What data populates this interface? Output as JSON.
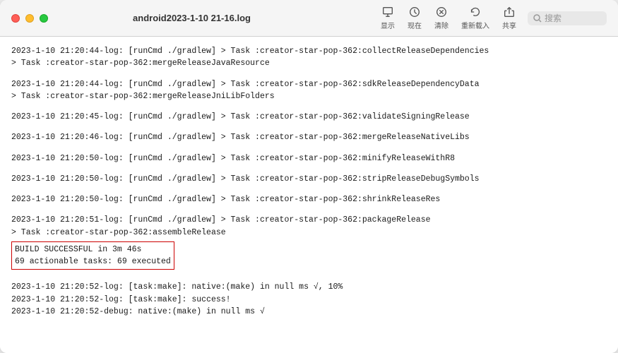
{
  "window": {
    "title": "android2023-1-10 21-16.log"
  },
  "toolbar": {
    "display_label": "显示",
    "now_label": "现在",
    "clear_label": "清除",
    "reload_label": "重新载入",
    "share_label": "共享",
    "search_placeholder": "搜索"
  },
  "log_lines": [
    "2023-1-10 21:20:44-log: [runCmd ./gradlew] > Task :creator-star-pop-362:collectReleaseDependencies",
    "> Task :creator-star-pop-362:mergeReleaseJavaResource",
    "",
    "2023-1-10 21:20:44-log: [runCmd ./gradlew] > Task :creator-star-pop-362:sdkReleaseDependencyData",
    "> Task :creator-star-pop-362:mergeReleaseJniLibFolders",
    "",
    "2023-1-10 21:20:45-log: [runCmd ./gradlew] > Task :creator-star-pop-362:validateSigningRelease",
    "",
    "2023-1-10 21:20:46-log: [runCmd ./gradlew] > Task :creator-star-pop-362:mergeReleaseNativeLibs",
    "",
    "2023-1-10 21:20:50-log: [runCmd ./gradlew] > Task :creator-star-pop-362:minifyReleaseWithR8",
    "",
    "2023-1-10 21:20:50-log: [runCmd ./gradlew] > Task :creator-star-pop-362:stripReleaseDebugSymbols",
    "",
    "2023-1-10 21:20:50-log: [runCmd ./gradlew] > Task :creator-star-pop-362:shrinkReleaseRes",
    "",
    "2023-1-10 21:20:51-log: [runCmd ./gradlew] > Task :creator-star-pop-362:packageRelease",
    "> Task :creator-star-pop-362:assembleRelease"
  ],
  "build_success": {
    "line1": "BUILD SUCCESSFUL in 3m 46s",
    "line2": "69 actionable tasks: 69 executed"
  },
  "log_lines_after": [
    "",
    "2023-1-10 21:20:52-log: [task:make]: native:(make) in null ms √, 10%",
    "2023-1-10 21:20:52-log: [task:make]: success!",
    "2023-1-10 21:20:52-debug: native:(make) in null ms √"
  ]
}
